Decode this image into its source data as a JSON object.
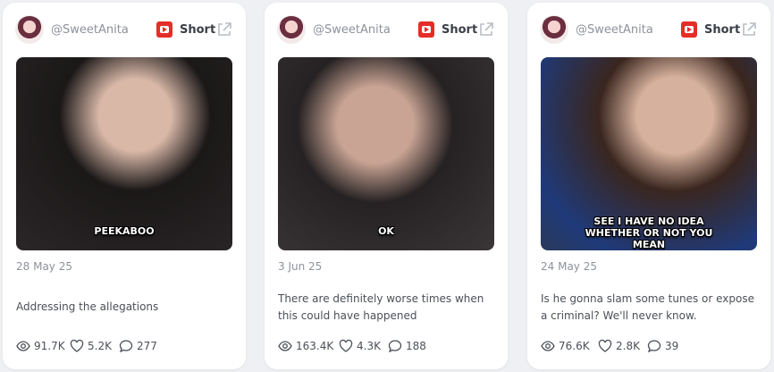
{
  "posts": [
    {
      "handle": "@SweetAnita",
      "type": "Short",
      "caption": "PEEKABOO",
      "date": "28 May 25",
      "title": "Addressing the allegations",
      "views": "91.7K",
      "likes": "5.2K",
      "comments": "277"
    },
    {
      "handle": "@SweetAnita",
      "type": "Short",
      "caption": "OK",
      "date": "3 Jun 25",
      "title": "There are definitely worse times when this could have happened",
      "views": "163.4K",
      "likes": "4.3K",
      "comments": "188"
    },
    {
      "handle": "@SweetAnita",
      "type": "Short",
      "caption": "SEE I HAVE NO IDEA WHETHER OR NOT YOU MEAN",
      "date": "24 May 25",
      "title": "Is he gonna slam some tunes or expose a criminal? We'll never know.",
      "views": "76.6K",
      "likes": "2.8K",
      "comments": "39"
    }
  ],
  "colors": {
    "youtube_red": "#e52d27",
    "muted_text": "#8d929c",
    "body_text": "#4b5058",
    "card_bg": "#ffffff",
    "page_bg": "#eef0f3"
  },
  "icons": [
    "youtube-icon",
    "external-link-icon",
    "eye-icon",
    "heart-icon",
    "comment-icon"
  ]
}
